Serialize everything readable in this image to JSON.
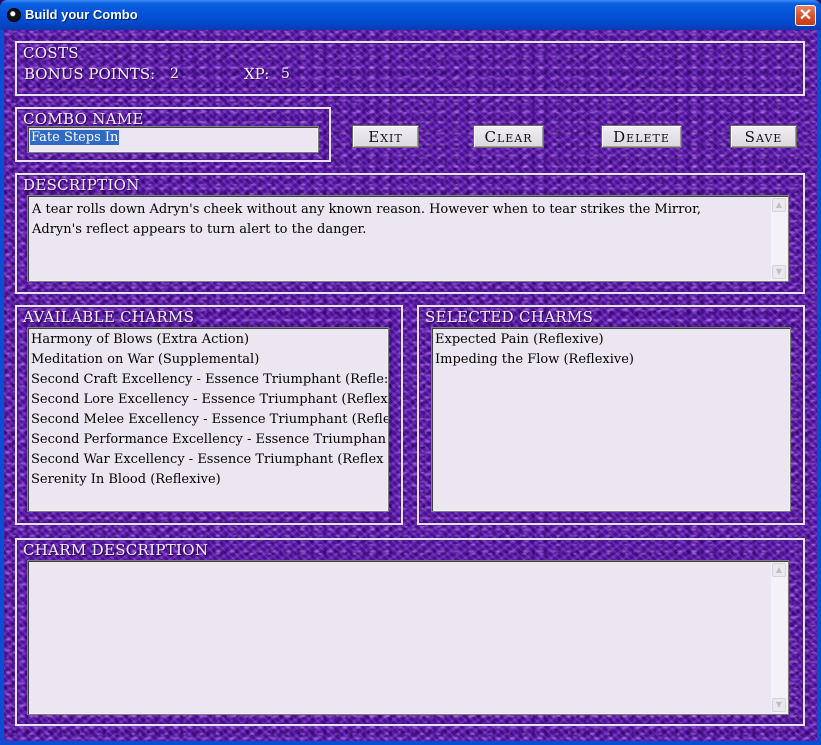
{
  "window": {
    "title": "Build your Combo",
    "close_glyph": "✕"
  },
  "costs": {
    "label": "COSTS",
    "bonus_label": "BONUS POINTS:",
    "bonus_value": "2",
    "xp_label": "XP:",
    "xp_value": "5"
  },
  "combo_name": {
    "label": "COMBO NAME",
    "value": "Fate Steps In"
  },
  "buttons": {
    "exit": "Exit",
    "clear": "Clear",
    "delete": "Delete",
    "save": "Save"
  },
  "description": {
    "label": "DESCRIPTION",
    "text_line1": "A tear rolls down Adryn's cheek without any known reason. However when to tear strikes the Mirror,",
    "text_line2": "Adryn's reflect appears to turn alert to the danger."
  },
  "available_charms": {
    "label": "AVAILABLE CHARMS",
    "items": [
      "Harmony of Blows (Extra Action)",
      "Meditation on War (Supplemental)",
      "Second Craft Excellency - Essence Triumphant (Refle:",
      "Second Lore Excellency - Essence Triumphant (Reflex",
      "Second Melee Excellency - Essence Triumphant (Refle",
      "Second Performance Excellency - Essence Triumphan",
      "Second War Excellency - Essence Triumphant (Reflex",
      "Serenity In Blood (Reflexive)"
    ]
  },
  "selected_charms": {
    "label": "SELECTED CHARMS",
    "items": [
      "Expected Pain (Reflexive)",
      "Impeding the Flow (Reflexive)"
    ]
  },
  "charm_description": {
    "label": "CHARM DESCRIPTION",
    "text": ""
  },
  "scroll": {
    "up": "▲",
    "down": "▼"
  }
}
